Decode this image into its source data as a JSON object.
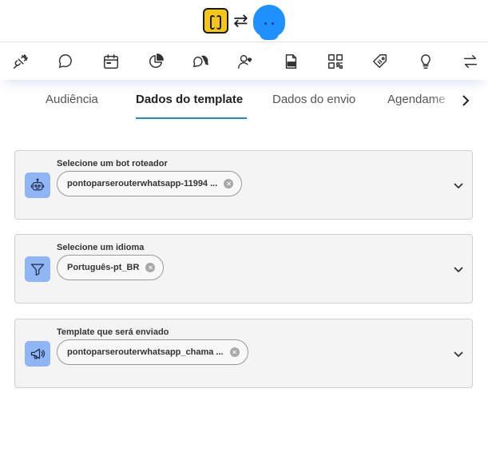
{
  "tabs": {
    "items": [
      {
        "label": "Audiência"
      },
      {
        "label": "Dados do template"
      },
      {
        "label": "Dados do envio"
      },
      {
        "label": "Agendame"
      }
    ]
  },
  "toolbar": {
    "icons": [
      "plug-icon",
      "chat-bubble-icon",
      "calendar-icon",
      "pie-chart-icon",
      "chat-bubbles-icon",
      "user-heart-icon",
      "document-code-icon",
      "qr-code-icon",
      "tag-icon",
      "lightbulb-icon",
      "swap-icon"
    ]
  },
  "cards": [
    {
      "label": "Selecione um bot roteador",
      "value": "pontoparserouterwhatsapp-11994 ...",
      "icon": "robot-icon"
    },
    {
      "label": "Selecione um idioma",
      "value": "Português-pt_BR",
      "icon": "filter-icon"
    },
    {
      "label": "Template que será enviado",
      "value": "pontoparserouterwhatsapp_chama ...",
      "icon": "megaphone-icon"
    }
  ],
  "colors": {
    "accent": "#1e88e5",
    "icon_bg": "#8fb5f5",
    "logo_yellow": "#f5c518",
    "logo_blue": "#1e90ff"
  }
}
